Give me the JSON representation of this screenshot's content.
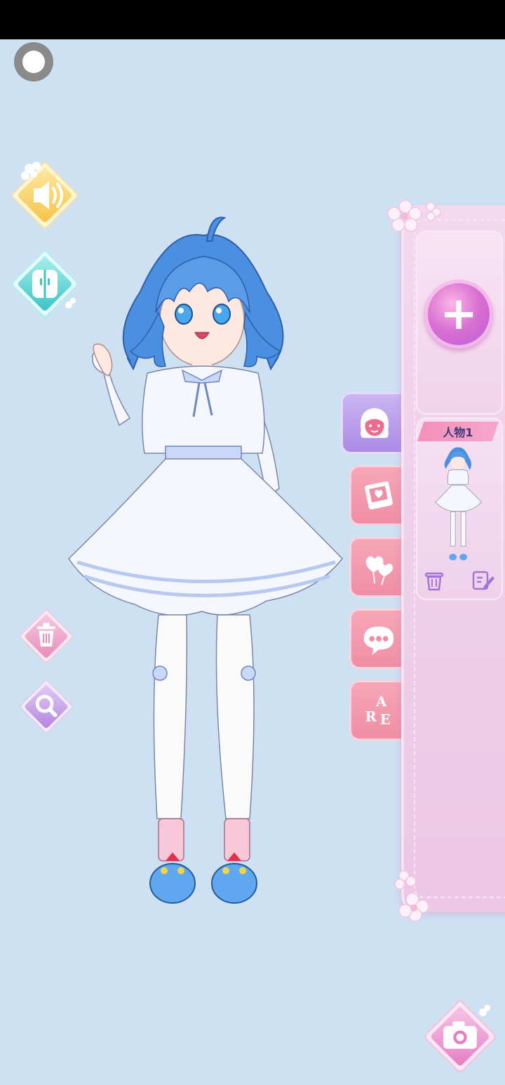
{
  "colors": {
    "background": "#cde1f3",
    "panel": "#efcfe8",
    "tab_pink": "#f08ea6",
    "tab_active": "#a98be6",
    "hair": "#4a8fe0",
    "dress": "#f4f7fd"
  },
  "left_toolbar": {
    "toggle_icon": "circle-toggle-icon",
    "sound_icon": "speaker-icon",
    "wardrobe_icon": "wardrobe-icon",
    "delete_icon": "trash-icon",
    "zoom_icon": "magnifier-icon"
  },
  "category_tabs": [
    {
      "icon": "face-icon",
      "active": true
    },
    {
      "icon": "photo-heart-icon",
      "active": false
    },
    {
      "icon": "heart-balloon-icon",
      "active": false
    },
    {
      "icon": "speech-bubble-icon",
      "active": false
    },
    {
      "icon": "letters-icon",
      "active": false
    }
  ],
  "side_panel": {
    "add_symbol": "+",
    "character_label": "人物1",
    "character_actions": [
      "trash-icon",
      "edit-icon"
    ]
  },
  "camera_icon": "camera-icon"
}
